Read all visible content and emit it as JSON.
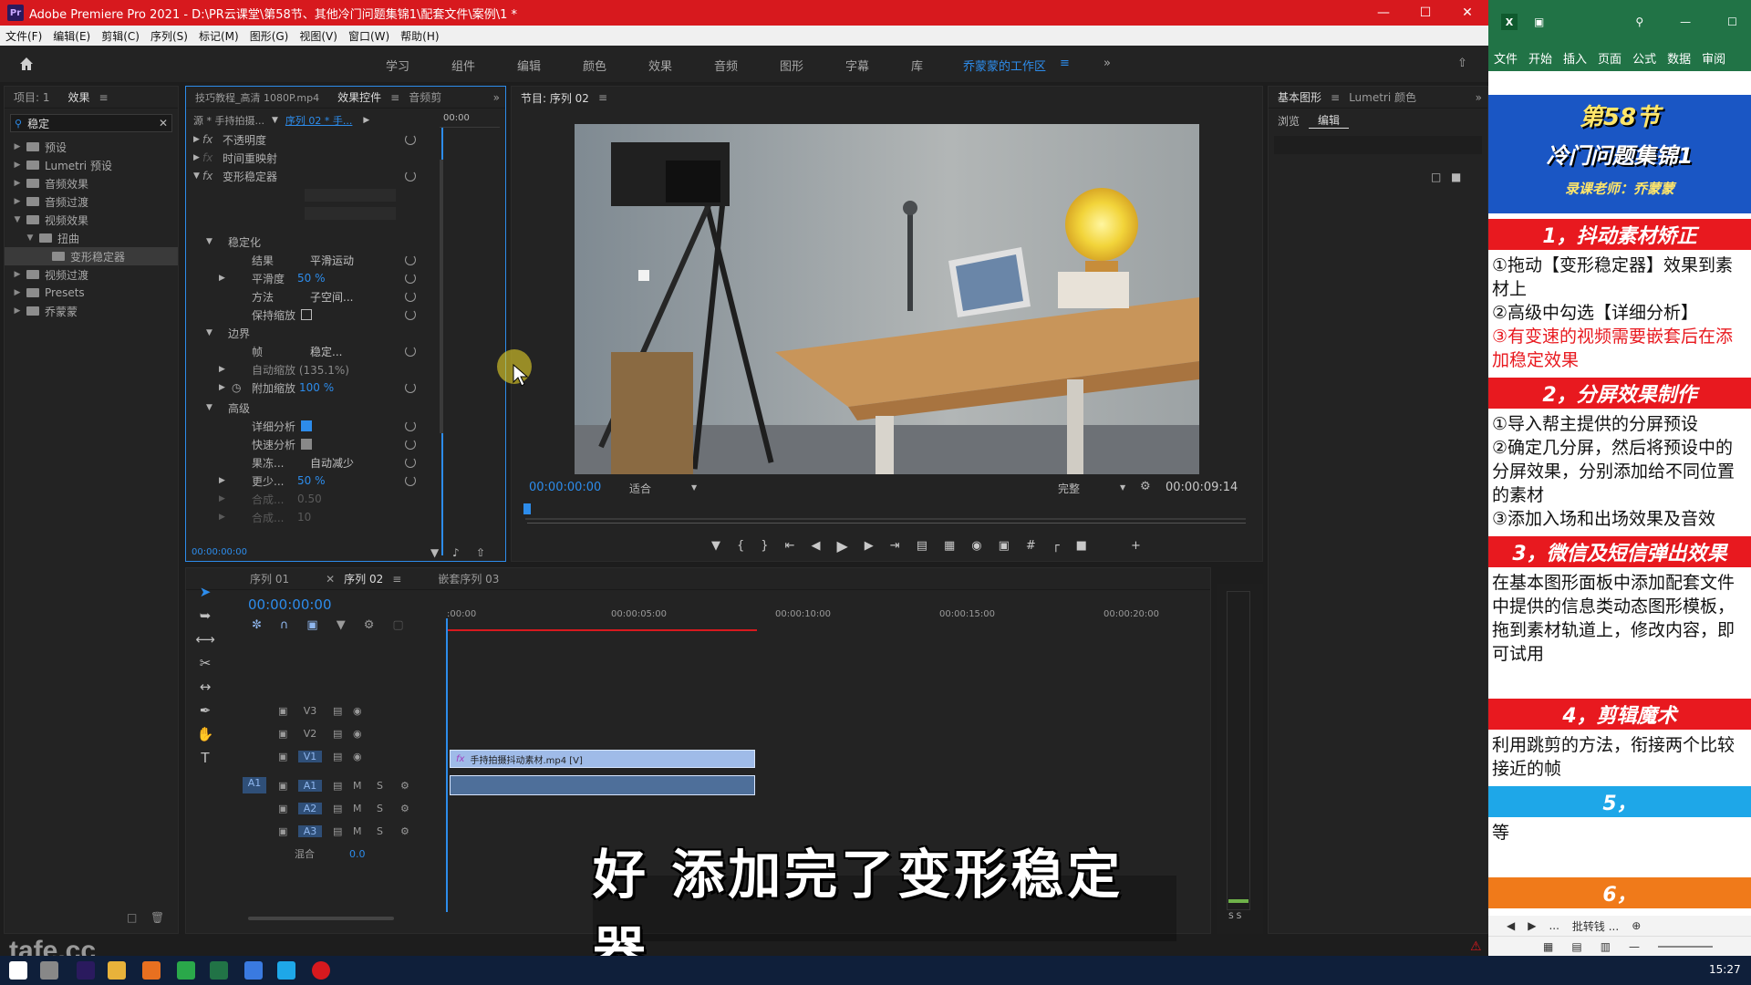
{
  "app": {
    "title": "Adobe Premiere Pro 2021 - D:\\PR云课堂\\第58节、其他冷门问题集锦1\\配套文件\\案例\\1 *",
    "menu": [
      "文件(F)",
      "编辑(E)",
      "剪辑(C)",
      "序列(S)",
      "标记(M)",
      "图形(G)",
      "视图(V)",
      "窗口(W)",
      "帮助(H)"
    ],
    "workspaces": [
      "学习",
      "组件",
      "编辑",
      "颜色",
      "效果",
      "音频",
      "图形",
      "字幕",
      "库",
      "乔蒙蒙的工作区"
    ],
    "active_workspace": "乔蒙蒙的工作区"
  },
  "effects_panel": {
    "tabs": [
      "项目: 1",
      "效果"
    ],
    "search_value": "稳定",
    "tree": [
      {
        "label": "预设",
        "level": 0,
        "open": false
      },
      {
        "label": "Lumetri 预设",
        "level": 0,
        "open": false
      },
      {
        "label": "音频效果",
        "level": 0,
        "open": false
      },
      {
        "label": "音频过渡",
        "level": 0,
        "open": false
      },
      {
        "label": "视频效果",
        "level": 0,
        "open": true
      },
      {
        "label": "扭曲",
        "level": 1,
        "open": true
      },
      {
        "label": "变形稳定器",
        "level": 2,
        "selected": true
      },
      {
        "label": "视频过渡",
        "level": 0,
        "open": false
      },
      {
        "label": "Presets",
        "level": 0,
        "open": false
      },
      {
        "label": "乔蒙蒙",
        "level": 0,
        "open": false
      }
    ]
  },
  "effect_controls": {
    "tabs": [
      "技巧教程_高清 1080P.mp4",
      "效果控件",
      "音频剪"
    ],
    "source": "源 * 手持拍摄...",
    "sequence": "序列 02 * 手...",
    "ruler_time": "00:00",
    "rows": {
      "opacity": "不透明度",
      "time_remap": "时间重映射",
      "warp": "变形稳定器",
      "stabilization": "稳定化",
      "result_label": "结果",
      "result_value": "平滑运动",
      "smoothness_label": "平滑度",
      "smoothness_value": "50 %",
      "method_label": "方法",
      "method_value": "子空间...",
      "keep_scale": "保持缩放",
      "borders": "边界",
      "framing_label": "帧",
      "framing_value": "稳定...",
      "auto_scale": "自动缩放 (135.1%)",
      "add_scale_label": "附加缩放",
      "add_scale_value": "100 %",
      "advanced": "高级",
      "detail_analysis": "详细分析",
      "fast_analysis": "快速分析",
      "rolling_label": "果冻...",
      "rolling_value": "自动减少",
      "less_label": "更少...",
      "less_value": "50 %",
      "synth1_label": "合成...",
      "synth1_value": "0.50",
      "synth2_label": "合成...",
      "synth2_value": "10"
    },
    "timecode": "00:00:00:00"
  },
  "program_monitor": {
    "title": "节目: 序列 02",
    "timecode_in": "00:00:00:00",
    "fit": "适合",
    "quality": "完整",
    "duration": "00:00:09:14"
  },
  "essential_graphics": {
    "tabs": [
      "基本图形",
      "Lumetri 颜色"
    ],
    "subtabs": [
      "浏览",
      "编辑"
    ]
  },
  "timeline": {
    "tabs": [
      "序列 01",
      "序列 02",
      "嵌套序列 03"
    ],
    "timecode": "00:00:00:00",
    "ruler": [
      ":00:00",
      "00:00:05:00",
      "00:00:10:00",
      "00:00:15:00",
      "00:00:20:00"
    ],
    "video_tracks": [
      "V3",
      "V2",
      "V1"
    ],
    "audio_tracks": [
      "A1",
      "A2",
      "A3"
    ],
    "source_track": "A1",
    "mix_label": "混合",
    "mix_value": "0.0",
    "clip_label": "手持拍摄抖动素材.mp4 [V]"
  },
  "caption": "好 添加完了变形稳定器",
  "watermark": "tafe.cc",
  "excel": {
    "ribbon": [
      "文件",
      "开始",
      "插入",
      "页面",
      "公式",
      "数据",
      "审阅"
    ],
    "header_title": "第58节",
    "header_sub": "冷门问题集锦1",
    "header_teacher": "录课老师：乔蒙蒙",
    "sections": [
      {
        "title": "1，抖动素材矫正",
        "color": "#e8191f",
        "lines": [
          {
            "text": "①拖动【变形稳定器】效果到素材上",
            "red": false
          },
          {
            "text": "②高级中勾选【详细分析】",
            "red": false
          },
          {
            "text": "③有变速的视频需要嵌套后在添加稳定效果",
            "red": true
          }
        ]
      },
      {
        "title": "2，分屏效果制作",
        "color": "#e8191f",
        "lines": [
          {
            "text": "①导入帮主提供的分屏预设",
            "red": false
          },
          {
            "text": "②确定几分屏，然后将预设中的分屏效果，分别添加给不同位置的素材",
            "red": false
          },
          {
            "text": "③添加入场和出场效果及音效",
            "red": false
          }
        ]
      },
      {
        "title": "3，微信及短信弹出效果",
        "color": "#e8191f",
        "lines": [
          {
            "text": "在基本图形面板中添加配套文件中提供的信息类动态图形模板，拖到素材轨道上，修改内容，即可试用",
            "red": false
          }
        ]
      },
      {
        "title": "4，剪辑魔术",
        "color": "#e8191f",
        "lines": [
          {
            "text": "利用跳剪的方法，衔接两个比较接近的帧",
            "red": false
          }
        ]
      },
      {
        "title": "5，",
        "color": "#1ea7e8",
        "lines": [
          {
            "text": "等",
            "red": false
          }
        ]
      },
      {
        "title": "6，",
        "color": "#f07a1a",
        "lines": []
      }
    ],
    "bottom_bar": "批转钱 ..."
  },
  "taskbar": {
    "time": "15:27"
  }
}
